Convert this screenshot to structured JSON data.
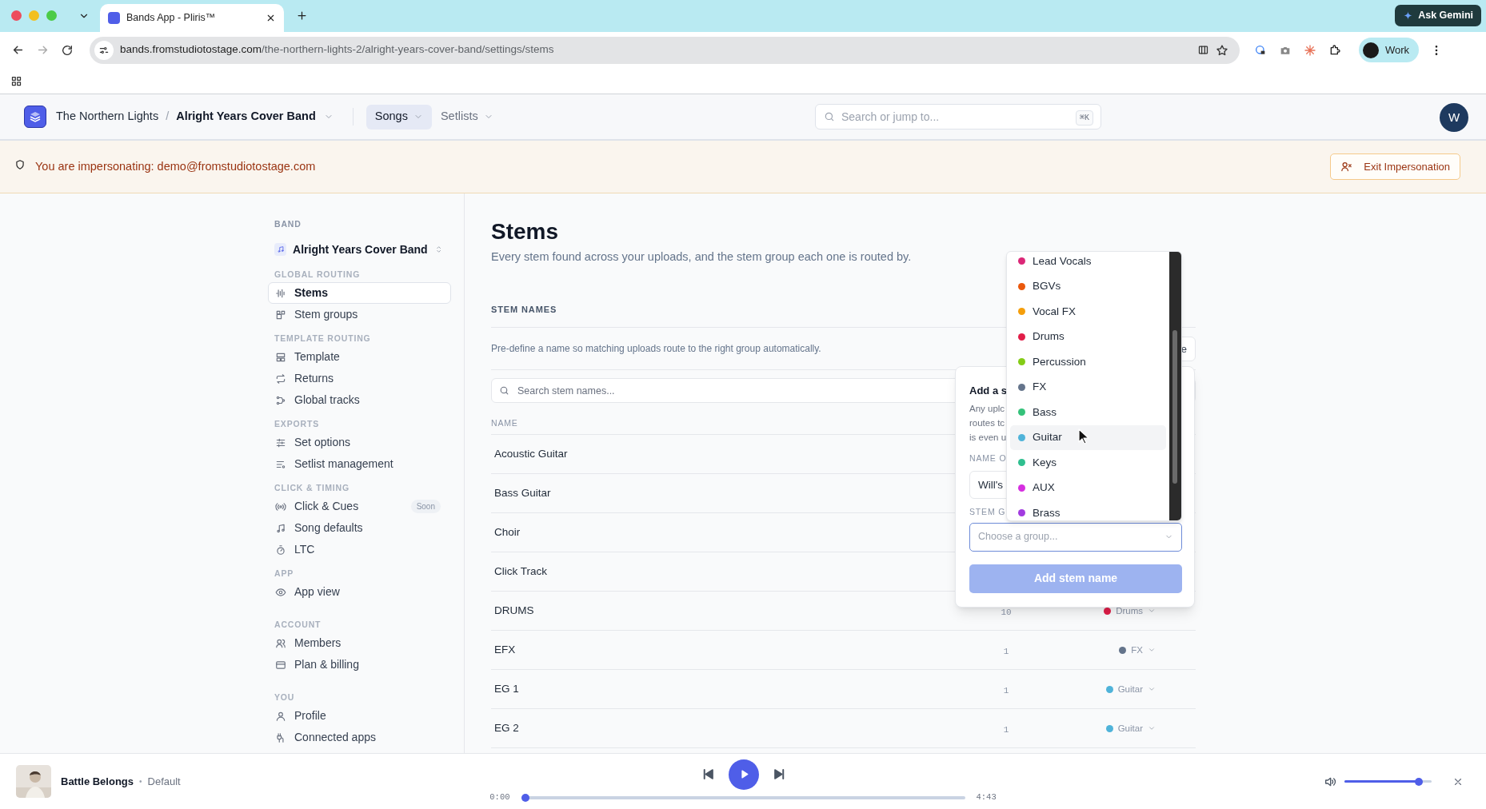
{
  "browser": {
    "tab_title": "Bands App - Pliris™",
    "gemini_button": "Ask Gemini",
    "url_host": "bands.fromstudiotostage.com",
    "url_path": "/the-northern-lights-2/alright-years-cover-band/settings/stems",
    "profile": "Work"
  },
  "header": {
    "org": "The Northern Lights",
    "separator": "/",
    "band": "Alright Years Cover Band",
    "nav": [
      {
        "label": "Songs",
        "selected": true
      },
      {
        "label": "Setlists",
        "selected": false
      }
    ],
    "search": {
      "placeholder": "Search or jump to...",
      "shortcut": "⌘K"
    },
    "avatar": "W"
  },
  "banner": {
    "message": "You are impersonating: demo@fromstudiotostage.com",
    "button": "Exit Impersonation"
  },
  "sidebar": {
    "band_label": "BAND",
    "band_name": "Alright Years Cover Band",
    "sections": [
      {
        "title": "GLOBAL ROUTING",
        "items": [
          {
            "label": "Stems",
            "selected": true
          },
          {
            "label": "Stem groups",
            "selected": false
          }
        ]
      },
      {
        "title": "TEMPLATE ROUTING",
        "items": [
          {
            "label": "Template",
            "selected": false
          },
          {
            "label": "Returns",
            "selected": false
          },
          {
            "label": "Global tracks",
            "selected": false
          }
        ]
      },
      {
        "title": "EXPORTS",
        "items": [
          {
            "label": "Set options",
            "selected": false
          },
          {
            "label": "Setlist management",
            "selected": false
          }
        ]
      },
      {
        "title": "CLICK & TIMING",
        "items": [
          {
            "label": "Click & Cues",
            "selected": false,
            "badge": "Soon"
          },
          {
            "label": "Song defaults",
            "selected": false
          },
          {
            "label": "LTC",
            "selected": false
          }
        ]
      },
      {
        "title": "APP",
        "items": [
          {
            "label": "App view",
            "selected": false
          }
        ]
      },
      {
        "title": "ACCOUNT",
        "items": [
          {
            "label": "Members",
            "selected": false
          },
          {
            "label": "Plan & billing",
            "selected": false
          }
        ]
      },
      {
        "title": "YOU",
        "items": [
          {
            "label": "Profile",
            "selected": false
          },
          {
            "label": "Connected apps",
            "selected": false
          }
        ]
      }
    ]
  },
  "page": {
    "title": "Stems",
    "subtitle": "Every stem found across your uploads, and the stem group each one is routed by.",
    "section_title": "STEM NAMES",
    "description": "Pre-define a name so matching uploads route to the right group automatically.",
    "partial_button": "e",
    "search": {
      "placeholder": "Search stem names..."
    },
    "columns": [
      "NAME"
    ],
    "rows": [
      {
        "name": "Acoustic Guitar"
      },
      {
        "name": "Bass Guitar"
      },
      {
        "name": "Choir"
      },
      {
        "name": "Click Track"
      },
      {
        "name": "DRUMS",
        "count": "10",
        "group": {
          "name": "Drums",
          "color": "#e11d48"
        }
      },
      {
        "name": "EFX",
        "count": "1",
        "group": {
          "name": "FX",
          "color": "#64748b"
        }
      },
      {
        "name": "EG 1",
        "count": "1",
        "group": {
          "name": "Guitar",
          "color": "#4fb3d9"
        }
      },
      {
        "name": "EG 2",
        "count": "1",
        "group": {
          "name": "Guitar",
          "color": "#4fb3d9"
        }
      }
    ]
  },
  "popover": {
    "title": "Add a s",
    "description_lines": [
      "Any uplc",
      "routes tc",
      "is even u"
    ],
    "name_label": "NAME O",
    "name_value": "Will's",
    "group_label": "STEM G",
    "group_select": {
      "placeholder": "Choose a group..."
    },
    "submit": {
      "label": "Add stem name",
      "disabled": true
    }
  },
  "group_menu": {
    "items": [
      {
        "label": "Lead Vocals",
        "color": "#db2777",
        "highlighted": false
      },
      {
        "label": "BGVs",
        "color": "#ea580c",
        "highlighted": false
      },
      {
        "label": "Vocal FX",
        "color": "#f59e0b",
        "highlighted": false
      },
      {
        "label": "Drums",
        "color": "#e11d48",
        "highlighted": false
      },
      {
        "label": "Percussion",
        "color": "#84cc16",
        "highlighted": false
      },
      {
        "label": "FX",
        "color": "#64748b",
        "highlighted": false
      },
      {
        "label": "Bass",
        "color": "#34c27a",
        "highlighted": false
      },
      {
        "label": "Guitar",
        "color": "#4fb3d9",
        "highlighted": true
      },
      {
        "label": "Keys",
        "color": "#2fbf8f",
        "highlighted": false
      },
      {
        "label": "AUX",
        "color": "#d62fe0",
        "highlighted": false
      },
      {
        "label": "Brass",
        "color": "#a23be0",
        "highlighted": false
      }
    ]
  },
  "player": {
    "title": "Battle Belongs",
    "separator": "•",
    "subtitle": "Default",
    "elapsed": "0:00",
    "duration": "4:43",
    "progress": {
      "level": 0
    },
    "volume": {
      "level": 0.85
    }
  }
}
